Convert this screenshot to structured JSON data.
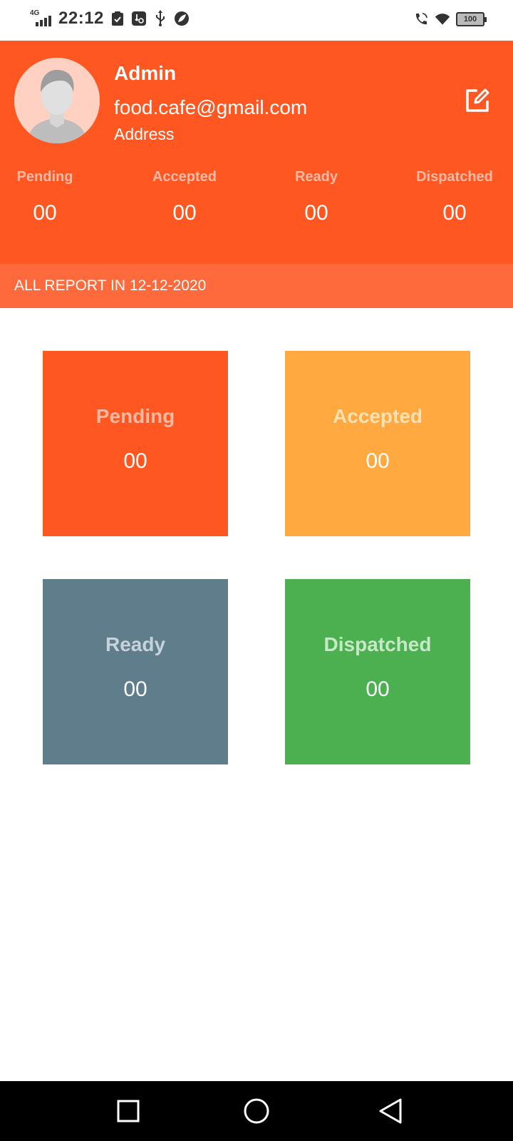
{
  "status_bar": {
    "network": "4G",
    "time": "22:12",
    "battery": "100",
    "icons": [
      "signal-icon",
      "clipboard-check-icon",
      "usb-settings-icon",
      "usb-icon",
      "leaf-icon",
      "wifi-calling-icon",
      "wifi-icon",
      "battery-icon"
    ]
  },
  "profile": {
    "name": "Admin",
    "email": "food.cafe@gmail.com",
    "address": "Address"
  },
  "header_stats": [
    {
      "label": "Pending",
      "value": "00"
    },
    {
      "label": "Accepted",
      "value": "00"
    },
    {
      "label": "Ready",
      "value": "00"
    },
    {
      "label": "Dispatched",
      "value": "00"
    }
  ],
  "report_banner": "ALL REPORT IN 12-12-2020",
  "tiles": [
    {
      "label": "Pending",
      "value": "00",
      "color": "#ff5722"
    },
    {
      "label": "Accepted",
      "value": "00",
      "color": "#ffa940"
    },
    {
      "label": "Ready",
      "value": "00",
      "color": "#607d8b"
    },
    {
      "label": "Dispatched",
      "value": "00",
      "color": "#4caf50"
    }
  ],
  "colors": {
    "primary": "#ff5722",
    "banner": "#ff6a3d"
  },
  "nav": [
    "recents-square-icon",
    "home-circle-icon",
    "back-triangle-icon"
  ]
}
